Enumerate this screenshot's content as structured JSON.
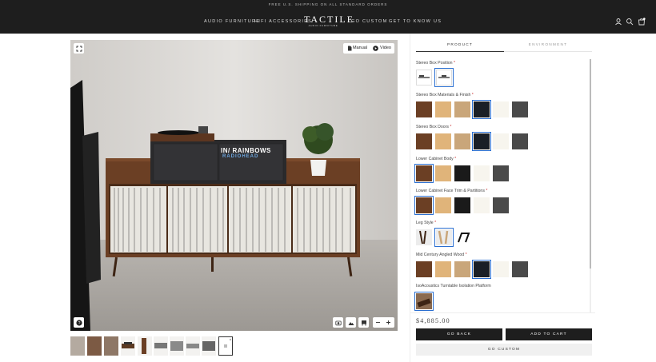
{
  "header": {
    "promo": "FREE U.S. SHIPPING ON ALL STANDARD ORDERS",
    "nav_left": [
      "AUDIO FURNITURE",
      "HIFI ACCESSORIES"
    ],
    "nav_right": [
      "GO CUSTOM",
      "GET TO KNOW US"
    ],
    "logo_title": "TACTILE",
    "logo_sub": "AUDIO FURNITURE",
    "icons": [
      "account-icon",
      "search-icon",
      "cart-icon"
    ]
  },
  "viewer": {
    "manual_label": "Manual",
    "video_label": "Video",
    "album_line1": "IN/ RAINBOWS",
    "album_line2": "RADIOHEAD"
  },
  "tabs": {
    "product": "PRODUCT",
    "environment": "ENVIRONMENT"
  },
  "options": [
    {
      "label": "Stereo Box Position"
    },
    {
      "label": "Stereo Box Materials & Finish"
    },
    {
      "label": "Stereo Box Doors"
    },
    {
      "label": "Lower Cabinet Body"
    },
    {
      "label": "Lower Cabinet Face Trim & Partitions"
    },
    {
      "label": "Leg Style"
    },
    {
      "label": "Mid Century Angled Wood"
    },
    {
      "label": "IsoAcoustics Turntable Isolation Platform"
    }
  ],
  "required_mark": "*",
  "price": "$4,885.00",
  "buttons": {
    "back": "GO BACK",
    "add": "ADD TO CART",
    "custom": "GO CUSTOM"
  },
  "colors": {
    "walnut": "#6b3f24",
    "maple": "#e0b47a",
    "oak": "#c9a67a",
    "black": "#1a1f26",
    "white": "#f7f5ee",
    "gray": "#4a4a4a",
    "accent": "#2a6fd1"
  }
}
